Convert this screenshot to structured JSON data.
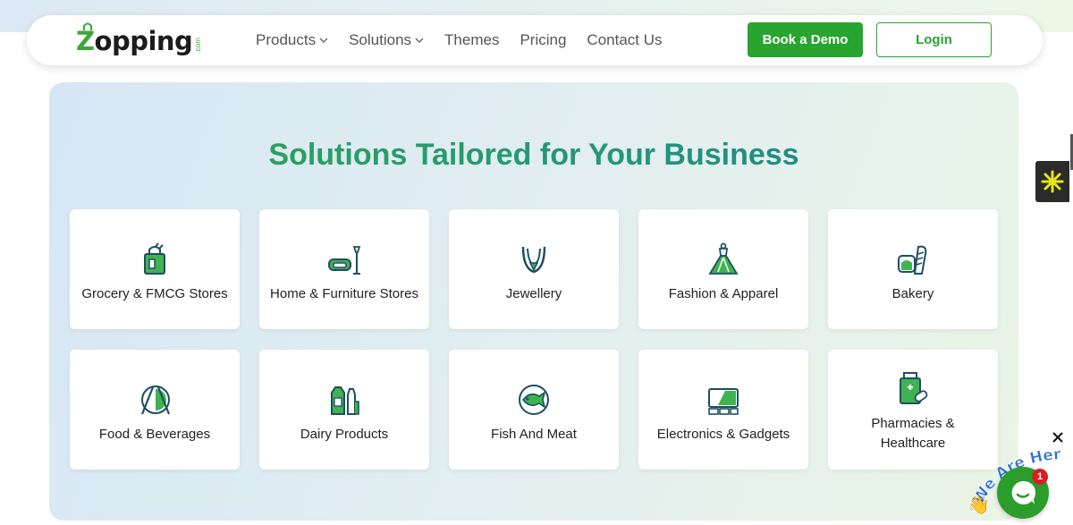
{
  "brand": {
    "name_z": "Z",
    "name_rest": "opping",
    "suffix": ".com"
  },
  "nav": {
    "items": [
      {
        "label": "Products",
        "has_dropdown": true
      },
      {
        "label": "Solutions",
        "has_dropdown": true
      },
      {
        "label": "Themes",
        "has_dropdown": false
      },
      {
        "label": "Pricing",
        "has_dropdown": false
      },
      {
        "label": "Contact Us",
        "has_dropdown": false
      }
    ],
    "demo_label": "Book a Demo",
    "login_label": "Login"
  },
  "section": {
    "title": "Solutions Tailored for Your Business",
    "cards": [
      {
        "label": "Grocery & FMCG Stores",
        "icon": "grocery-bag-icon"
      },
      {
        "label": "Home & Furniture Stores",
        "icon": "sofa-lamp-icon"
      },
      {
        "label": "Jewellery",
        "icon": "necklace-icon"
      },
      {
        "label": "Fashion & Apparel",
        "icon": "dress-icon"
      },
      {
        "label": "Bakery",
        "icon": "bread-icon"
      },
      {
        "label": "Food & Beverages",
        "icon": "plate-cutlery-icon"
      },
      {
        "label": "Dairy Products",
        "icon": "milk-bottles-icon"
      },
      {
        "label": "Fish And Meat",
        "icon": "fish-icon"
      },
      {
        "label": "Electronics & Gadgets",
        "icon": "devices-icon"
      },
      {
        "label": "Pharmacies & Healthcare",
        "icon": "medicine-icon"
      }
    ]
  },
  "chat": {
    "tagline": "We Are Here!",
    "badge_count": "1"
  },
  "colors": {
    "accent": "#27a52f",
    "icon_dark": "#1e4e63",
    "title_teal": "#1e7f95"
  }
}
